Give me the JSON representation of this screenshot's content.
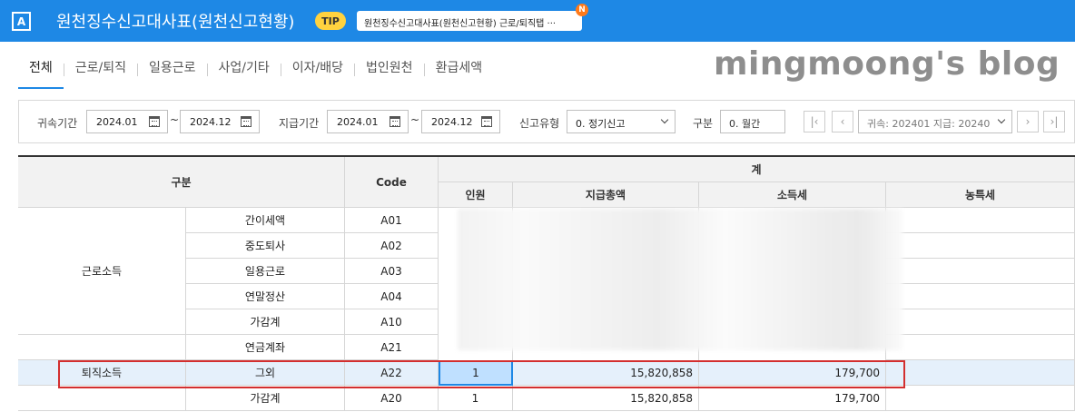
{
  "window": {
    "app_icon_letter": "A",
    "title": "원천징수신고대사표(원천신고현황)",
    "tip_label": "TIP",
    "tip_text": "원천징수신고대사표(원천신고현황) 근로/퇴직탭 ···",
    "new_badge": "N"
  },
  "tabs": [
    "전체",
    "근로/퇴직",
    "일용근로",
    "사업/기타",
    "이자/배당",
    "법인원천",
    "환급세액"
  ],
  "watermark": "mingmoong's blog",
  "filters": {
    "attribution_label": "귀속기간",
    "attribution_from": "2024.01",
    "attribution_to": "2024.12",
    "payment_label": "지급기간",
    "payment_from": "2024.01",
    "payment_to": "2024.12",
    "report_type_label": "신고유형",
    "report_type_value": "0. 정기신고",
    "division_label": "구분",
    "division_value": "0. 월간",
    "period_select_value": "귀속: 202401 지급: 20240",
    "tilde": "~"
  },
  "grid": {
    "headers": {
      "category": "구분",
      "code": "Code",
      "total_group": "계",
      "persons": "인원",
      "total_paid": "지급총액",
      "income_tax": "소득세",
      "rural_tax": "농특세"
    },
    "rows": [
      {
        "group": "근로소득",
        "item": "간이세액",
        "code": "A01",
        "persons": "",
        "total_paid": "",
        "income_tax": ""
      },
      {
        "group": "",
        "item": "중도퇴사",
        "code": "A02",
        "persons": "",
        "total_paid": "",
        "income_tax": ""
      },
      {
        "group": "",
        "item": "일용근로",
        "code": "A03",
        "persons": "",
        "total_paid": "",
        "income_tax": ""
      },
      {
        "group": "",
        "item": "연말정산",
        "code": "A04",
        "persons": "",
        "total_paid": "",
        "income_tax": ""
      },
      {
        "group": "",
        "item": "가감계",
        "code": "A10",
        "persons": "",
        "total_paid": "",
        "income_tax": ""
      },
      {
        "group": "",
        "item": "연금계좌",
        "code": "A21",
        "persons": "",
        "total_paid": "",
        "income_tax": ""
      },
      {
        "group": "퇴직소득",
        "item": "그외",
        "code": "A22",
        "persons": "1",
        "total_paid": "15,820,858",
        "income_tax": "179,700"
      },
      {
        "group": "",
        "item": "가감계",
        "code": "A20",
        "persons": "1",
        "total_paid": "15,820,858",
        "income_tax": "179,700"
      }
    ]
  }
}
